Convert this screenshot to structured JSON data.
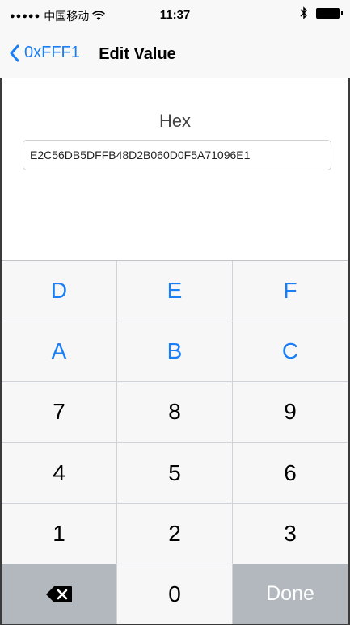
{
  "status_bar": {
    "carrier": "中国移动",
    "time": "11:37"
  },
  "nav": {
    "back_label": "0xFFF1",
    "title": "Edit Value"
  },
  "editor": {
    "label": "Hex",
    "value": "E2C56DB5DFFB48D2B060D0F5A71096E1"
  },
  "keypad": {
    "keys": [
      "D",
      "E",
      "F",
      "A",
      "B",
      "C",
      "7",
      "8",
      "9",
      "4",
      "5",
      "6",
      "1",
      "2",
      "3"
    ],
    "zero": "0",
    "done": "Done",
    "delete_icon": "backspace-icon"
  },
  "colors": {
    "accent": "#1a7ef5",
    "function_key": "#b3b8bf"
  }
}
